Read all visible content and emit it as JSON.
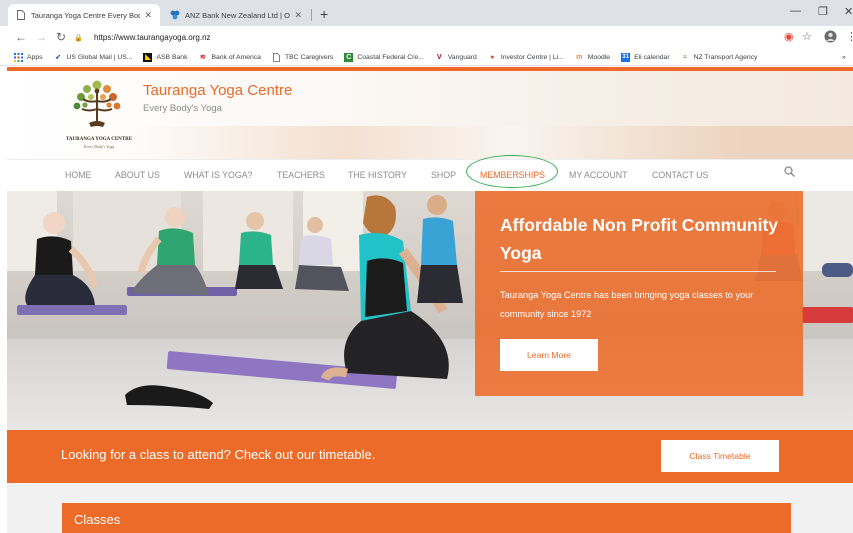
{
  "browser": {
    "tabs": [
      {
        "title": "Tauranga Yoga Centre Every Bod"
      },
      {
        "title": "ANZ Bank New Zealand Ltd | Onl"
      }
    ],
    "new_tab": "+",
    "url": "https://www.taurangayoga.org.nz",
    "bookmarks": [
      {
        "label": "Apps"
      },
      {
        "label": "US Global Mail | US..."
      },
      {
        "label": "ASB Bank"
      },
      {
        "label": "Bank of America"
      },
      {
        "label": "TBC Caregivers"
      },
      {
        "label": "Coastal Federal Cre..."
      },
      {
        "label": "Vanguard"
      },
      {
        "label": "Investor Centre | Li..."
      },
      {
        "label": "Moodle"
      },
      {
        "label": "Eli calendar"
      },
      {
        "label": "NZ Transport Agency"
      }
    ],
    "more": "»"
  },
  "site": {
    "title": "Tauranga Yoga Centre",
    "subtitle": "Every Body's Yoga",
    "logo_name": "TAURANGA YOGA CENTRE",
    "logo_tag": "Every Body's Yoga",
    "accent": "#ec6a26",
    "nav": [
      {
        "label": "HOME"
      },
      {
        "label": "ABOUT US"
      },
      {
        "label": "WHAT IS YOGA?"
      },
      {
        "label": "TEACHERS"
      },
      {
        "label": "THE HISTORY"
      },
      {
        "label": "SHOP"
      },
      {
        "label": "MEMBERSHIPS"
      },
      {
        "label": "MY ACCOUNT"
      },
      {
        "label": "CONTACT US"
      }
    ],
    "highlight_color": "#3fae5a"
  },
  "hero": {
    "title": "Affordable Non Profit Community Yoga",
    "text": "Tauranga Yoga Centre has been bringing yoga classes to your community since 1972",
    "button": "Learn More"
  },
  "timetable": {
    "text": "Looking for a class to attend? Check out our timetable.",
    "button": "Class Timetable"
  },
  "classes": {
    "title": "Classes"
  }
}
